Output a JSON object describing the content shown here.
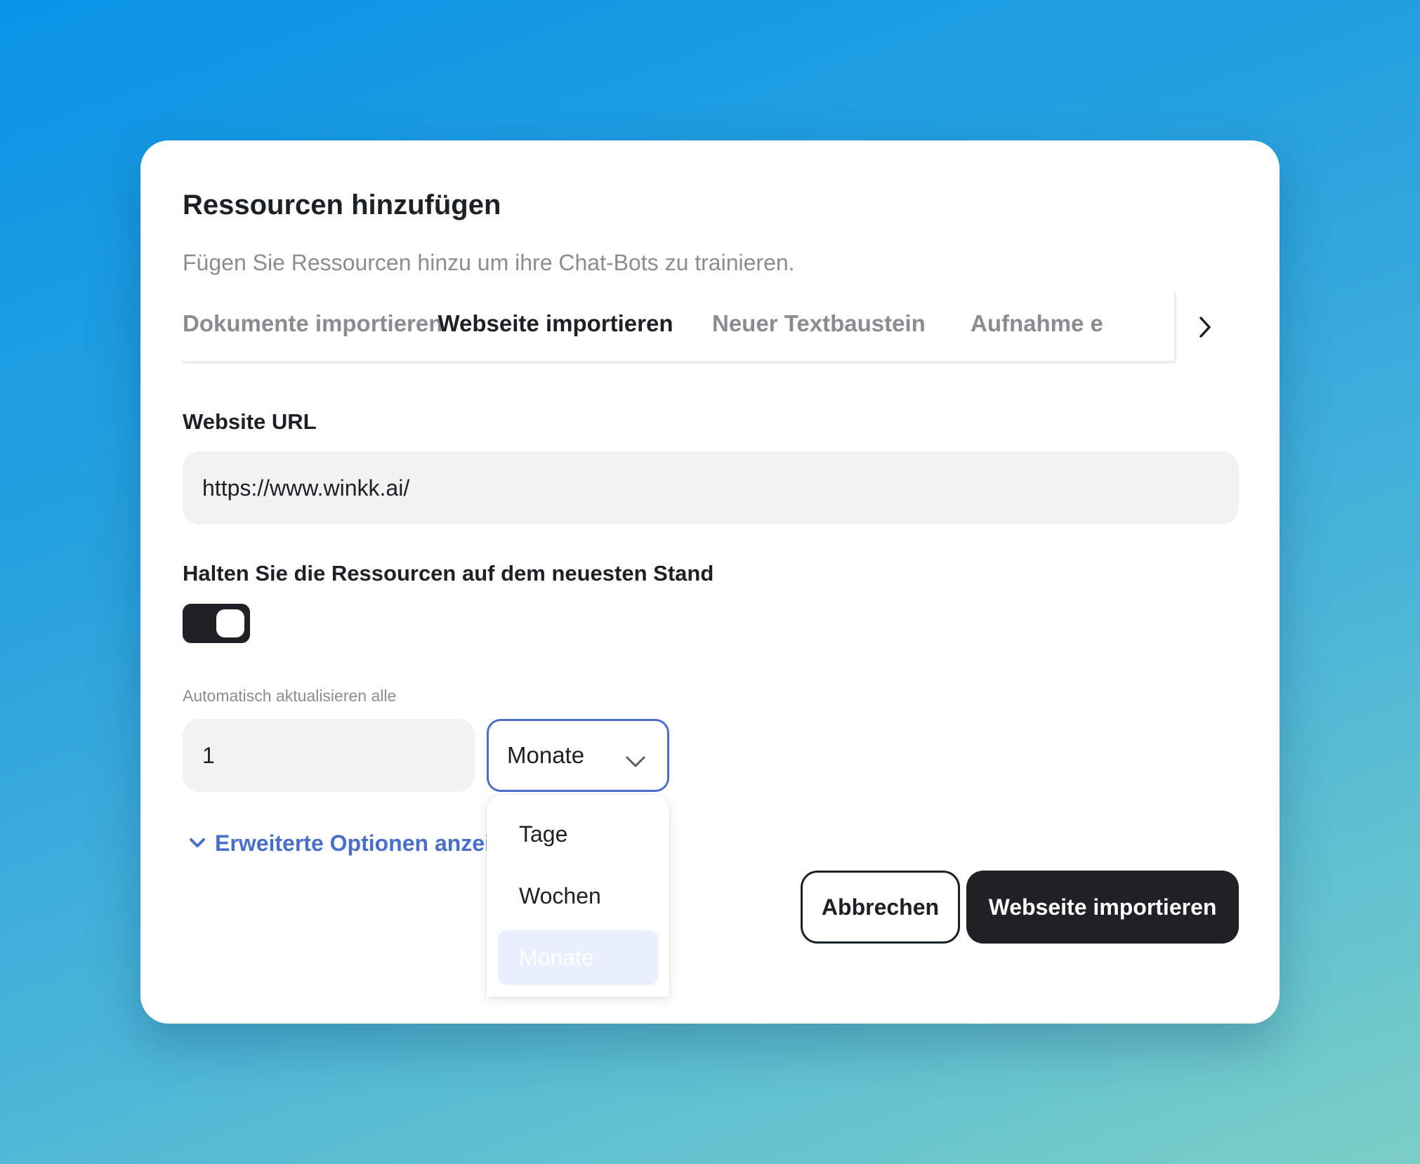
{
  "dialog": {
    "title": "Ressourcen hinzufügen",
    "subtitle": "Fügen Sie Ressourcen hinzu um ihre Chat-Bots zu trainieren."
  },
  "tabs": [
    {
      "label": "Dokumente importieren",
      "active": false
    },
    {
      "label": "Webseite importieren",
      "active": true
    },
    {
      "label": "Neuer Textbaustein",
      "active": false
    },
    {
      "label": "Aufnahme e",
      "active": false
    }
  ],
  "tabs_next_icon": "chevron-right-icon",
  "url_field": {
    "label": "Website URL",
    "value": "https://www.winkk.ai/"
  },
  "keep_updated": {
    "label": "Halten Sie die Ressourcen auf dem neuesten Stand",
    "enabled": true
  },
  "auto_update": {
    "label": "Automatisch aktualisieren alle",
    "interval_value": "1",
    "unit_selected": "Monate",
    "unit_options": [
      "Tage",
      "Wochen",
      "Monate"
    ]
  },
  "advanced": {
    "label": "Erweiterte Optionen anzeigen",
    "icon": "chevron-down-icon"
  },
  "actions": {
    "cancel_label": "Abbrechen",
    "submit_label": "Webseite importieren"
  },
  "colors": {
    "accent_blue": "#4a6fcb",
    "dark": "#1f2124",
    "input_bg": "#f2f2f2",
    "selected_option_bg": "#e9efff"
  }
}
